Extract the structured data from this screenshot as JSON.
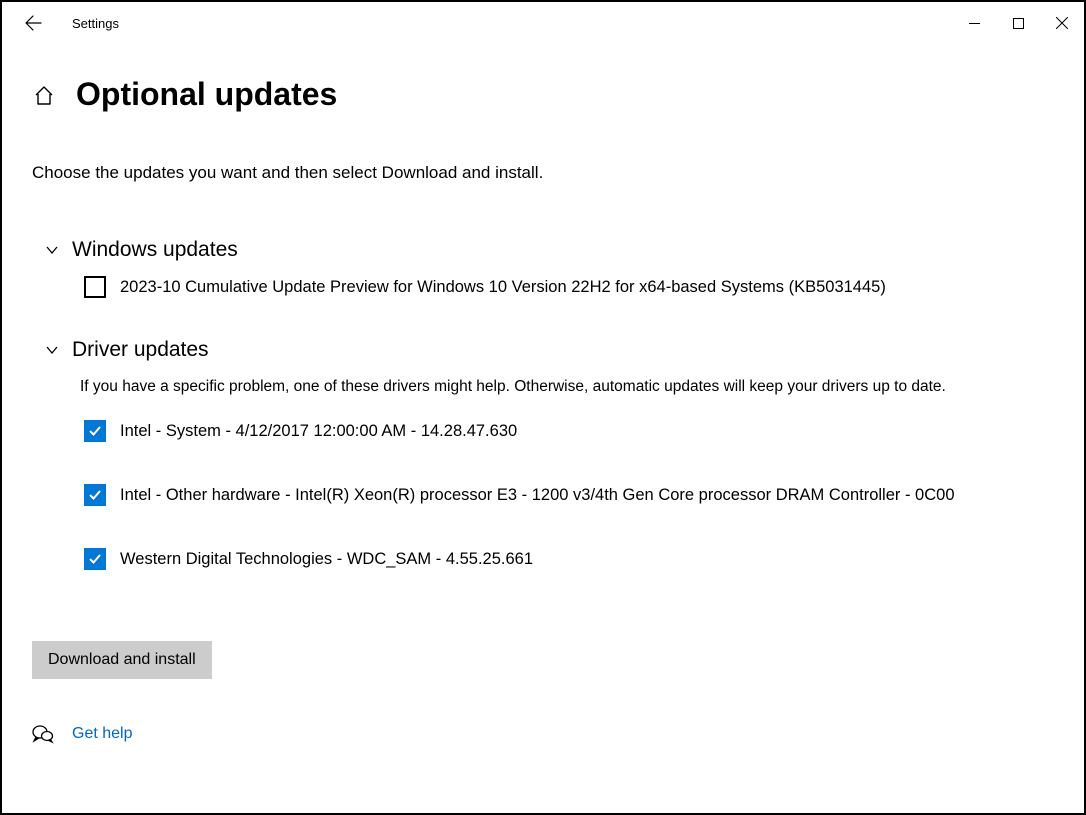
{
  "titlebar": {
    "app_title": "Settings"
  },
  "header": {
    "page_title": "Optional updates"
  },
  "instruction": "Choose the updates you want and then select Download and install.",
  "sections": {
    "windows": {
      "title": "Windows updates",
      "items": [
        {
          "label": "2023-10 Cumulative Update Preview for Windows 10 Version 22H2 for x64-based Systems (KB5031445)",
          "checked": false
        }
      ]
    },
    "drivers": {
      "title": "Driver updates",
      "description": "If you have a specific problem, one of these drivers might help. Otherwise, automatic updates will keep your drivers up to date.",
      "items": [
        {
          "label": "Intel - System - 4/12/2017 12:00:00 AM - 14.28.47.630",
          "checked": true
        },
        {
          "label": "Intel - Other hardware - Intel(R) Xeon(R) processor E3 - 1200 v3/4th Gen Core processor DRAM Controller - 0C00",
          "checked": true
        },
        {
          "label": "Western Digital Technologies - WDC_SAM - 4.55.25.661",
          "checked": true
        }
      ]
    }
  },
  "action_button": "Download and install",
  "help": {
    "label": "Get help"
  }
}
